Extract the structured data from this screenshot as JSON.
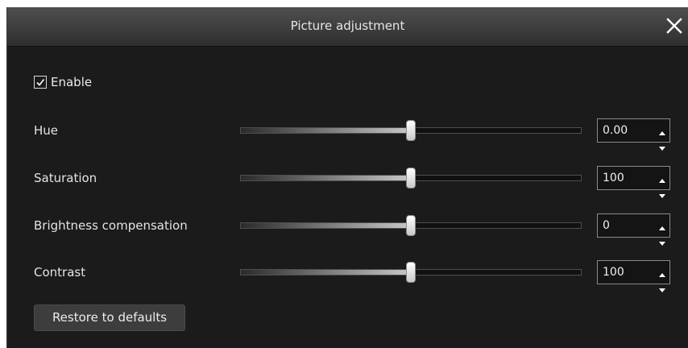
{
  "window": {
    "title": "Picture adjustment"
  },
  "enable": {
    "label": "Enable",
    "checked": true
  },
  "rows": [
    {
      "label": "Hue",
      "value": "0.00",
      "level": 0.5
    },
    {
      "label": "Saturation",
      "value": "100",
      "level": 0.5
    },
    {
      "label": "Brightness compensation",
      "value": "0",
      "level": 0.5
    },
    {
      "label": "Contrast",
      "value": "100",
      "level": 0.5
    }
  ],
  "restore": {
    "label": "Restore to defaults"
  },
  "icons": {
    "close": "close-icon",
    "check": "checkmark-icon",
    "spin_up": "arrow-up-icon",
    "spin_down": "arrow-down-icon"
  }
}
